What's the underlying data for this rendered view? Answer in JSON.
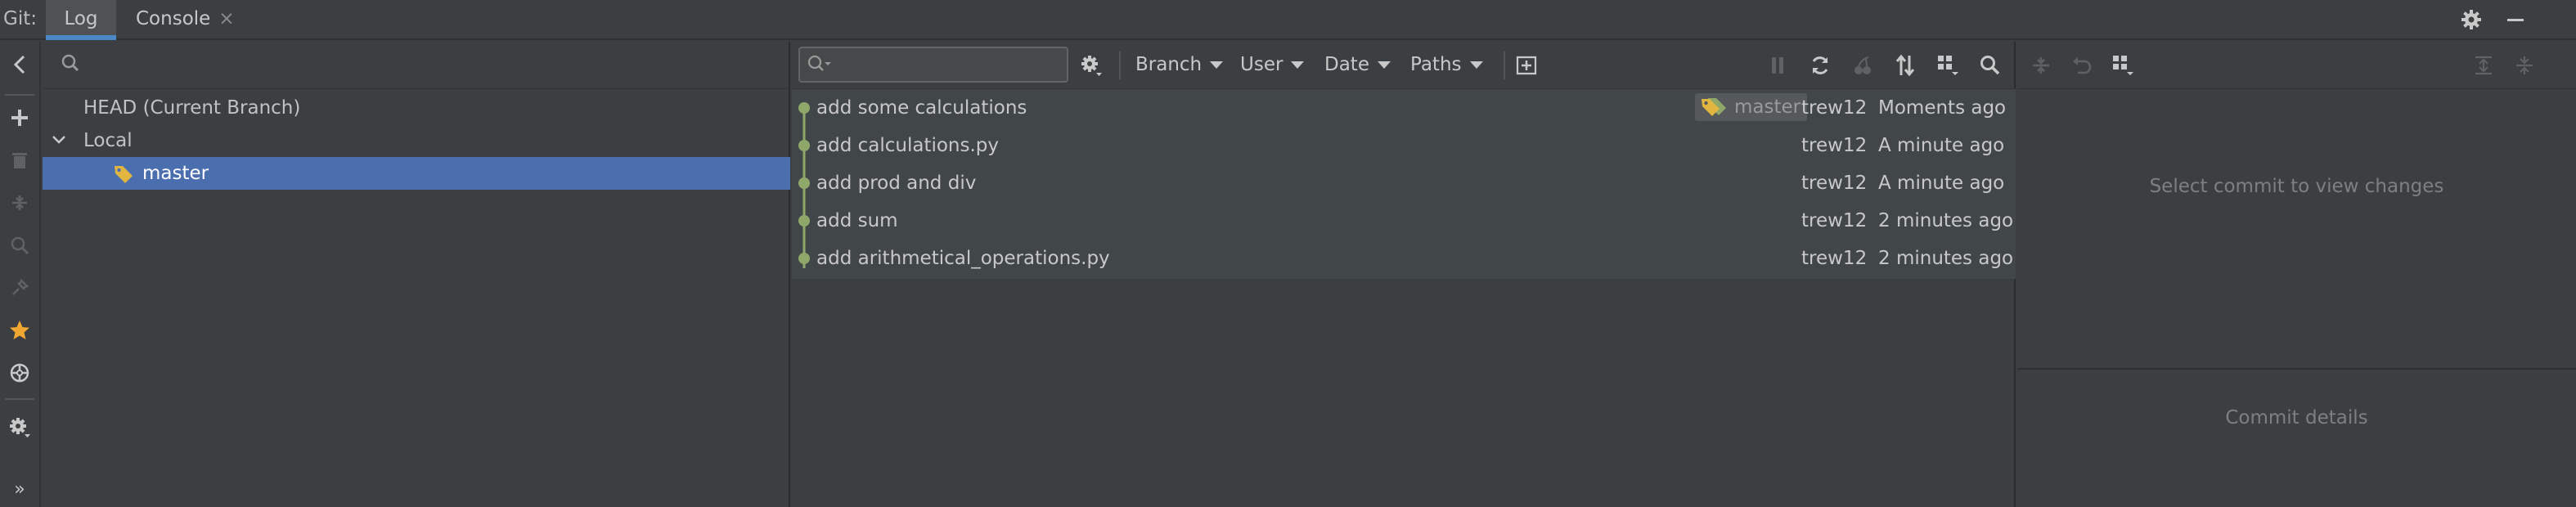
{
  "titlebar": {
    "prefix": "Git:",
    "tabs": [
      {
        "label": "Log"
      },
      {
        "label": "Console",
        "close": "×"
      }
    ]
  },
  "left_toolbar": {
    "icons": [
      "chevron-left-icon",
      "plus-icon",
      "trash-icon",
      "merge-icon",
      "search-icon",
      "pin-icon",
      "star-icon",
      "target-icon",
      "gear-icon",
      "expand-icon"
    ],
    "more_glyph": "»"
  },
  "branches": {
    "search_placeholder": "",
    "head": "HEAD (Current Branch)",
    "local": "Local",
    "branch": "master"
  },
  "log": {
    "filter_placeholder": "",
    "filters": {
      "branch": "Branch",
      "user": "User",
      "date": "Date",
      "paths": "Paths"
    },
    "commits": [
      {
        "message": "add some calculations",
        "tag": "master",
        "author": "trew12",
        "date": "Moments ago"
      },
      {
        "message": "add calculations.py",
        "author": "trew12",
        "date": "A minute ago"
      },
      {
        "message": "add prod and div",
        "author": "trew12",
        "date": "A minute ago"
      },
      {
        "message": "add sum",
        "author": "trew12",
        "date": "2 minutes ago"
      },
      {
        "message": "add arithmetical_operations.py",
        "author": "trew12",
        "date": "2 minutes ago"
      }
    ]
  },
  "details": {
    "changes_placeholder": "Select commit to view changes",
    "details_placeholder": "Commit details"
  },
  "colors": {
    "accent": "#4a88c7",
    "selection": "#4b6eaf",
    "graph": "#8fa86a",
    "tag": "#e0b640",
    "star": "#f0a732"
  }
}
